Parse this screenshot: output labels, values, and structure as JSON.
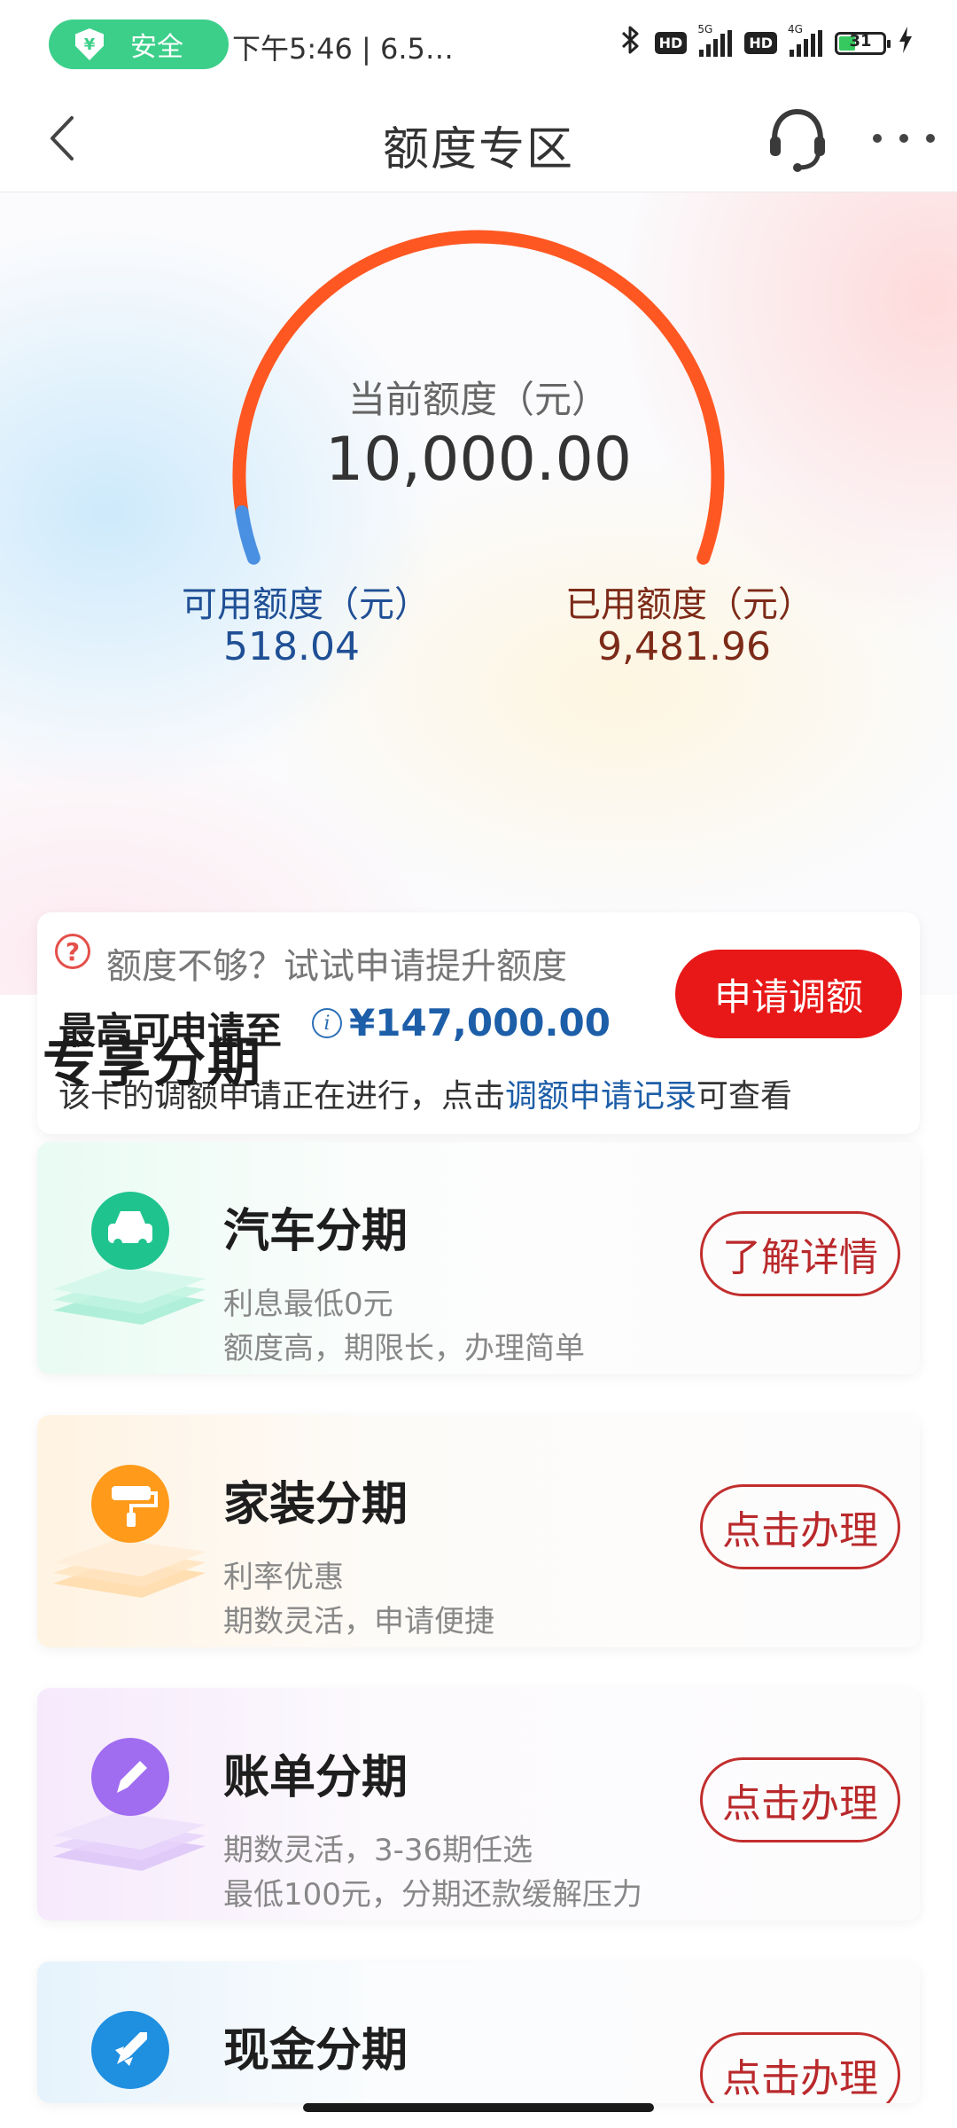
{
  "status_bar": {
    "safe_label": "安全",
    "time": "下午5:46 | 6.5…",
    "net_5g": "5G",
    "net_4g": "4G",
    "hd": "HD",
    "battery": "31"
  },
  "nav": {
    "title": "额度专区"
  },
  "credit": {
    "current_label": "当前额度（元）",
    "current_value": "10,000.00",
    "available_label": "可用额度（元）",
    "available_value": "518.04",
    "used_label": "已用额度（元）",
    "used_value": "9,481.96",
    "available_ratio": 0.0518,
    "colors": {
      "available": "#4a90e2",
      "used": "#ff5722"
    }
  },
  "quota_card": {
    "prompt": "额度不够？试试申请提升额度",
    "max_label": "最高可申请至",
    "max_amount": "¥147,000.00",
    "apply_button": "申请调额",
    "notice_prefix": "该卡的调额申请正在进行，点击",
    "notice_link": "调额申请记录",
    "notice_suffix": "可查看",
    "colors": {
      "button": "#e81818",
      "link": "#1d5ea8"
    }
  },
  "section": {
    "title": "专享分期"
  },
  "products": [
    {
      "icon": "car-icon",
      "title": "汽车分期",
      "line1": "利息最低0元",
      "line2": "额度高，期限长，办理简单",
      "button": "了解详情",
      "accent": "#1fc38e"
    },
    {
      "icon": "paint-roller-icon",
      "title": "家装分期",
      "line1": "利率优惠",
      "line2": "期数灵活，申请便捷",
      "button": "点击办理",
      "accent": "#ff9a1a"
    },
    {
      "icon": "pen-icon",
      "title": "账单分期",
      "line1": "期数灵活，3-36期任选",
      "line2": "最低100元，分期还款缓解压力",
      "button": "点击办理",
      "accent": "#a06cf0"
    },
    {
      "icon": "rocket-icon",
      "title": "现金分期",
      "line1": "",
      "line2": "",
      "button": "点击办理",
      "accent": "#1f8fe0"
    }
  ]
}
